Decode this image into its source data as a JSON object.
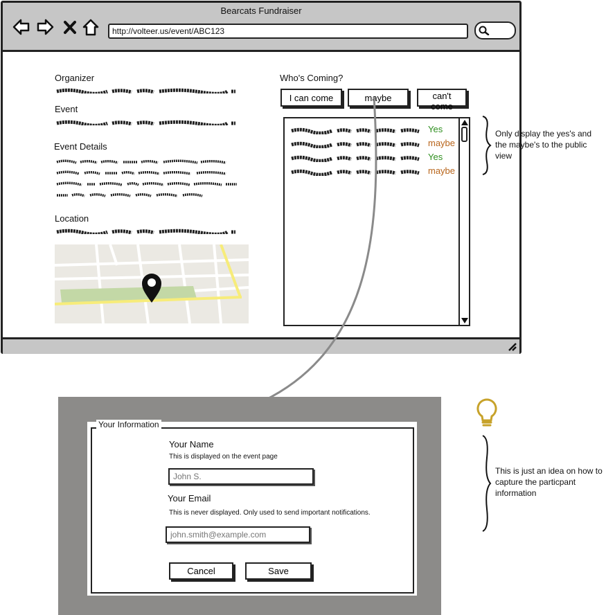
{
  "window": {
    "title": "Bearcats Fundraiser",
    "url": "http://volteer.us/event/ABC123"
  },
  "event": {
    "organizer_label": "Organizer",
    "event_label": "Event",
    "details_label": "Event Details",
    "location_label": "Location"
  },
  "rsvp": {
    "heading": "Who's Coming?",
    "buttons": [
      "I can come",
      "maybe",
      "can't come"
    ],
    "attendees": [
      {
        "status": "Yes"
      },
      {
        "status": "maybe"
      },
      {
        "status": "Yes"
      },
      {
        "status": "maybe"
      }
    ]
  },
  "notes": {
    "list_note": "Only display the yes's and the maybe's to the public view",
    "dialog_note": "This is just an idea on how to capture the particpant information"
  },
  "dialog": {
    "legend": "Your Information",
    "name_label": "Your Name",
    "name_help": "This is displayed on the event page",
    "name_placeholder": "John S.",
    "email_label": "Your Email",
    "email_help": "This is never displayed. Only used to send important notifications.",
    "email_placeholder": "john.smith@example.com",
    "cancel_label": "Cancel",
    "save_label": "Save"
  },
  "colors": {
    "yes": "#2f8f1f",
    "maybe": "#b8651b",
    "map_road_yellow": "#f7ec7a",
    "map_park_green": "#c3d8a6",
    "map_base": "#ebe9e3",
    "bulb": "#c7a22a",
    "overlay": "#8c8b89"
  }
}
